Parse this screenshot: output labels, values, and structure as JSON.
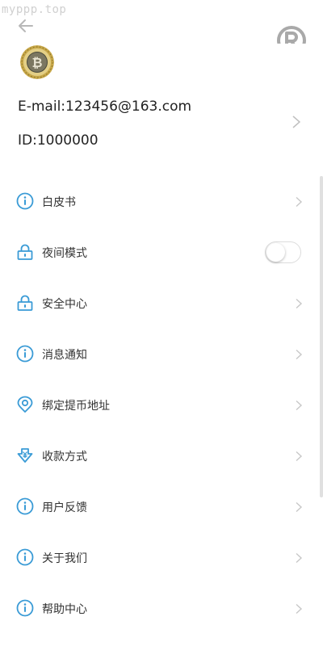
{
  "watermark": "myppp.top",
  "header": {
    "back_icon": "arrow-left-icon",
    "logo_icon": "registered-r-icon"
  },
  "profile": {
    "avatar_icon": "bitcoin-coin-avatar",
    "email": "E-mail:123456@163.com",
    "id": "ID:1000000"
  },
  "colors": {
    "accent": "#3a9bd6",
    "text": "#222222",
    "chevron": "#c8c8c8"
  },
  "menu": {
    "items": [
      {
        "label": "白皮书",
        "icon": "info-circle-icon"
      },
      {
        "label": "夜间模式",
        "icon": "lock-icon",
        "toggle_on": false
      },
      {
        "label": "安全中心",
        "icon": "lock-icon"
      },
      {
        "label": "消息通知",
        "icon": "info-circle-icon"
      },
      {
        "label": "绑定提币地址",
        "icon": "location-pin-icon"
      },
      {
        "label": "收款方式",
        "icon": "yen-receive-icon"
      },
      {
        "label": "用户反馈",
        "icon": "info-circle-icon"
      },
      {
        "label": "关于我们",
        "icon": "info-circle-icon"
      },
      {
        "label": "帮助中心",
        "icon": "info-circle-icon"
      }
    ]
  }
}
